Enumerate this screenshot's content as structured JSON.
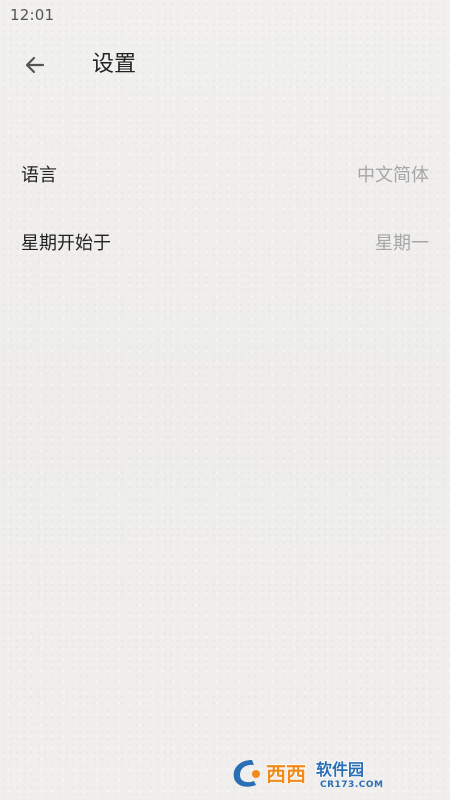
{
  "status_bar": {
    "time": "12:01"
  },
  "toolbar": {
    "back_icon": "arrow-left-icon",
    "title": "设置"
  },
  "settings": [
    {
      "label": "语言",
      "value": "中文简体"
    },
    {
      "label": "星期开始于",
      "value": "星期一"
    }
  ],
  "watermark": {
    "brand": "西西",
    "site_name": "软件园",
    "site_url": "CR173.COM"
  },
  "colors": {
    "background": "#efeeec",
    "primary_text": "#222222",
    "secondary_text": "#a6a6a6",
    "watermark_blue": "#2a6fb5",
    "watermark_orange": "#f08a1c"
  }
}
